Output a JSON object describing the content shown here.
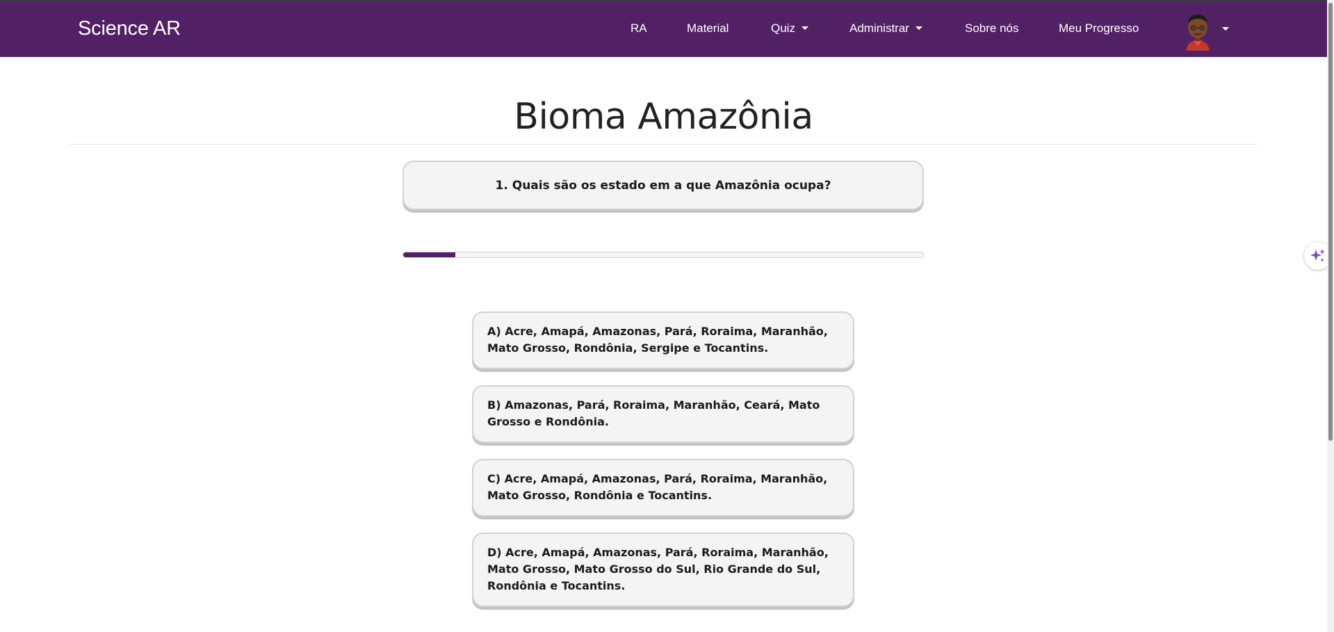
{
  "navbar": {
    "brand": "Science AR",
    "items": [
      {
        "label": "RA",
        "dropdown": false
      },
      {
        "label": "Material",
        "dropdown": false
      },
      {
        "label": "Quiz",
        "dropdown": true
      },
      {
        "label": "Administrar",
        "dropdown": true
      },
      {
        "label": "Sobre nós",
        "dropdown": false
      },
      {
        "label": "Meu Progresso",
        "dropdown": false
      }
    ],
    "avatar_icon": "user-avatar-icon"
  },
  "quiz": {
    "title": "Bioma Amazônia",
    "question": "1. Quais são os estado em a que Amazônia ocupa?",
    "progress_fraction": 0.1,
    "answers": [
      {
        "label": "A) Acre, Amapá, Amazonas, Pará, Roraima, Maranhão, Mato Grosso, Rondônia, Sergipe e Tocantins."
      },
      {
        "label": "B) Amazonas, Pará, Roraima, Maranhão, Ceará, Mato Grosso e Rondônia."
      },
      {
        "label": "C) Acre, Amapá, Amazonas, Pará, Roraima, Maranhão, Mato Grosso, Rondônia e Tocantins."
      },
      {
        "label": "D) Acre, Amapá, Amazonas, Pará, Roraima, Maranhão, Mato Grosso, Mato Grosso do Sul, Rio Grande do Sul, Rondônia e Tocantins."
      }
    ]
  },
  "widget_icon": "sparkle-icon",
  "colors": {
    "navbar": "#522165",
    "progress": "#522165",
    "card_bg": "#f4f4f4",
    "widget_accent": "#7a4fc4"
  }
}
